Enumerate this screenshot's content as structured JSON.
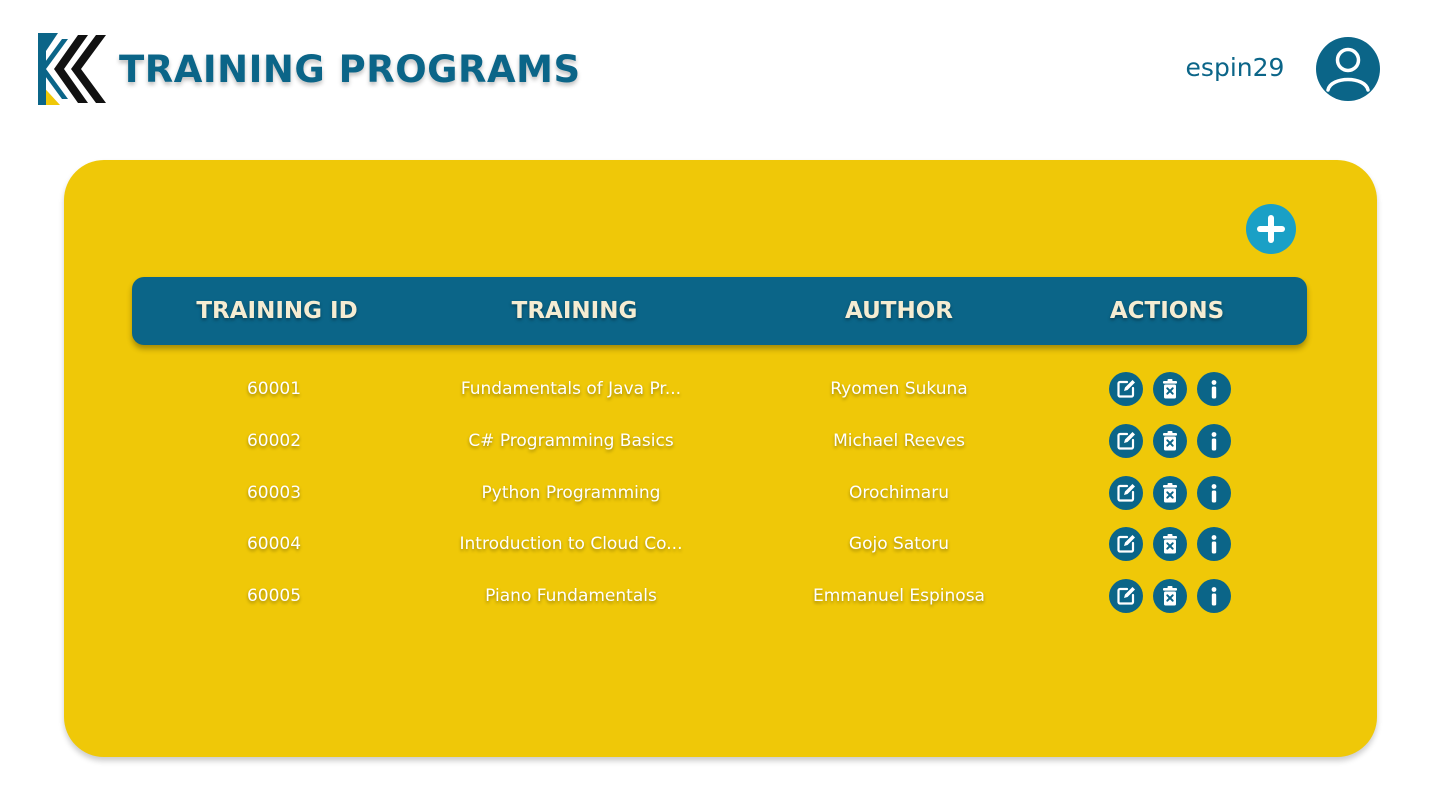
{
  "header": {
    "title": "TRAINING PROGRAMS",
    "username": "espin29",
    "logo_icon": "chevron-k-logo",
    "avatar_icon": "user-icon"
  },
  "colors": {
    "primary": "#0b6588",
    "panel": "#efc808",
    "add_button": "#1aa0c6",
    "logo_yellow": "#efc808",
    "text_light": "#ffffff",
    "header_text": "#f5ecd2"
  },
  "table": {
    "columns": [
      "TRAINING ID",
      "TRAINING",
      "AUTHOR",
      "ACTIONS"
    ],
    "rows": [
      {
        "id": "60001",
        "training": "Fundamentals of Java Pr...",
        "author": "Ryomen Sukuna"
      },
      {
        "id": "60002",
        "training": "C# Programming Basics",
        "author": "Michael Reeves"
      },
      {
        "id": "60003",
        "training": "Python Programming",
        "author": "Orochimaru"
      },
      {
        "id": "60004",
        "training": "Introduction to Cloud Co...",
        "author": "Gojo Satoru"
      },
      {
        "id": "60005",
        "training": "Piano Fundamentals",
        "author": "Emmanuel Espinosa"
      }
    ],
    "row_actions": [
      "edit-icon",
      "delete-icon",
      "info-icon"
    ]
  },
  "add_button_icon": "plus-icon"
}
